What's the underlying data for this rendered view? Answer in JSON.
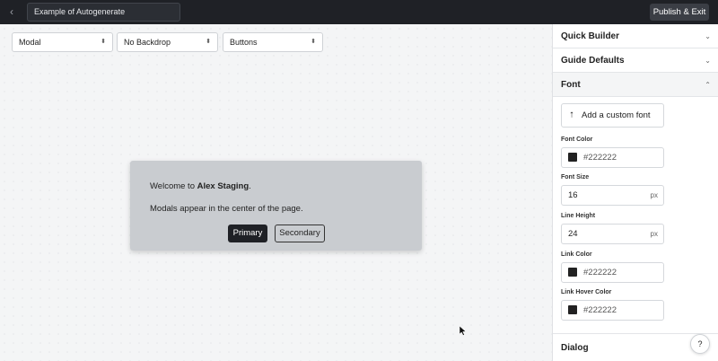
{
  "topbar": {
    "back_icon": "chevron-left-icon",
    "guide_title": "Example of Autogenerate",
    "publish_label": "Publish & Exit"
  },
  "toolbar": {
    "type_select": "Modal",
    "backdrop_select": "No Backdrop",
    "buttons_select": "Buttons",
    "caret_icon": "up-down-caret-icon"
  },
  "modal": {
    "welcome_prefix": "Welcome to ",
    "welcome_name": "Alex Staging",
    "welcome_suffix": ".",
    "body": "Modals appear in the center of the page.",
    "primary_label": "Primary",
    "secondary_label": "Secondary"
  },
  "panel": {
    "quick_builder": "Quick Builder",
    "guide_defaults": "Guide Defaults",
    "font_section": "Font",
    "add_font_label": "Add a custom font",
    "font_color_label": "Font Color",
    "font_color_value": "#222222",
    "font_size_label": "Font Size",
    "font_size_value": "16",
    "font_size_unit": "px",
    "line_height_label": "Line Height",
    "line_height_value": "24",
    "line_height_unit": "px",
    "link_color_label": "Link Color",
    "link_color_value": "#222222",
    "link_hover_label": "Link Hover Color",
    "link_hover_value": "#222222",
    "dialog_section": "Dialog",
    "help_label": "?"
  },
  "colors": {
    "topbar": "#1f2126",
    "modal_bg": "#c9ccd0",
    "primary_button": "#1f2126",
    "swatch": "#222222"
  }
}
